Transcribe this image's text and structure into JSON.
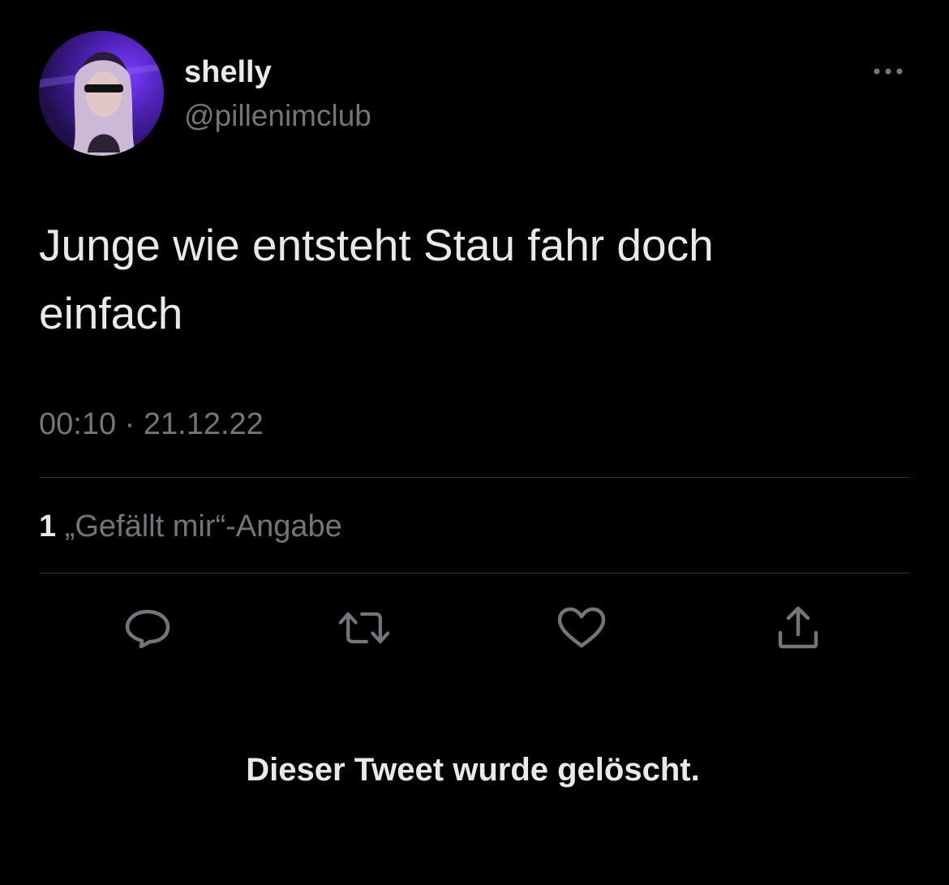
{
  "tweet": {
    "author": {
      "display_name": "shelly",
      "handle": "@pillenimclub",
      "avatar_icon": "profile-photo"
    },
    "text": "Junge wie entsteht Stau fahr doch einfach",
    "time": "00:10",
    "separator": "·",
    "date": "21.12.22",
    "likes": {
      "count": "1",
      "label": "„Gefällt mir“-Angabe"
    },
    "actions": [
      {
        "name": "reply",
        "icon": "speech-bubble-icon"
      },
      {
        "name": "retweet",
        "icon": "retweet-arrows-icon"
      },
      {
        "name": "like",
        "icon": "heart-icon"
      },
      {
        "name": "share",
        "icon": "share-upload-icon"
      }
    ],
    "more_icon": "more-dots-icon"
  },
  "notice": {
    "deleted": "Dieser Tweet wurde gelöscht."
  },
  "colors": {
    "background": "#000000",
    "primary_text": "#e7e9ea",
    "secondary_text": "#71767b",
    "divider": "#2f3336",
    "avatar_accent": "#7a3cff"
  }
}
